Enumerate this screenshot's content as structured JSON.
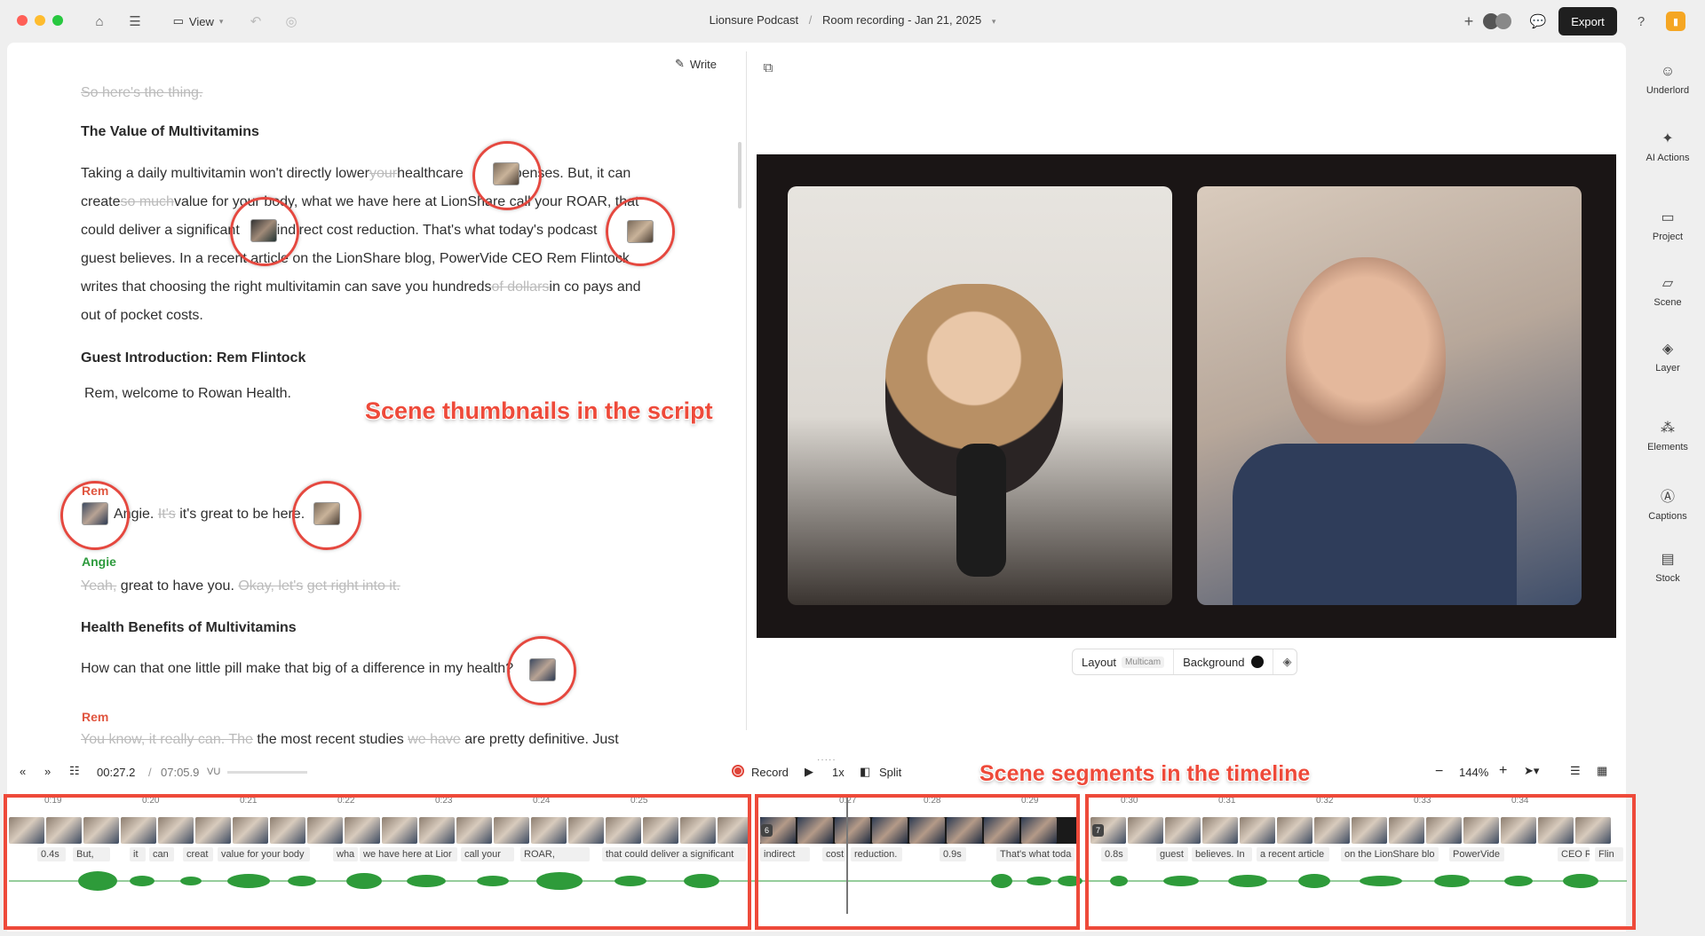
{
  "titlebar": {
    "view_label": "View",
    "project": "Lionsure Podcast",
    "separator": "/",
    "recording": "Room recording - Jan 21, 2025",
    "export_label": "Export"
  },
  "script": {
    "write_label": "Write",
    "faded_line": "So here's the thing.",
    "heading1": "The Value of Multivitamins",
    "p1": {
      "l1a": "Taking a daily multivitamin won't directly lower",
      "l1s": "your",
      "l1b": "healthcare",
      "l1c": "expenses. But, it can",
      "l2a": "create",
      "l2s": "so much",
      "l2b": "value for your body, what we have here at LionShare call your ROAR, that",
      "l3a": "could deliver a significant",
      "l3b": "indirect cost reduction. That's what today's podcast",
      "l4": "guest believes. In a recent article on the LionShare blog, PowerVide CEO Rem Flintock",
      "l5a": "writes that choosing the right multivitamin can save you hundreds",
      "l5s": "of dollars",
      "l5b": "in co pays and",
      "l6": "out of pocket costs."
    },
    "heading2": "Guest Introduction: Rem Flintock",
    "welcome": "Rem, welcome to Rowan Health.",
    "speaker_rem": "Rem",
    "rem_line_a": "Angie.",
    "rem_line_s": "It's",
    "rem_line_b": "it's great to be here.",
    "speaker_angie": "Angie",
    "angie_s1": "Yeah,",
    "angie_a": "great to have you.",
    "angie_s2": "Okay, let's",
    "angie_s3": "get right into it.",
    "heading3": "Health Benefits of Multivitamins",
    "question": "How can that one little pill make that big of a difference in my health?",
    "speaker_rem2": "Rem",
    "rem2_s1": "You know, it really can. The",
    "rem2_a": "the most recent studies",
    "rem2_s2": "we have",
    "rem2_b": "are pretty definitive. Just"
  },
  "annotations": {
    "script_callout": "Scene thumbnails in the script",
    "timeline_callout": "Scene segments in the timeline"
  },
  "preview": {
    "layout_label": "Layout",
    "layout_value": "Multicam",
    "background_label": "Background"
  },
  "sidebar": {
    "items": [
      {
        "label": "Underlord",
        "icon": "robot-icon"
      },
      {
        "label": "AI Actions",
        "icon": "sparkle-icon"
      },
      {
        "label": "Project",
        "icon": "folder-icon"
      },
      {
        "label": "Scene",
        "icon": "scene-icon"
      },
      {
        "label": "Layer",
        "icon": "layers-icon"
      },
      {
        "label": "Elements",
        "icon": "elements-icon"
      },
      {
        "label": "Captions",
        "icon": "captions-icon"
      },
      {
        "label": "Stock",
        "icon": "stock-icon"
      }
    ]
  },
  "transport": {
    "current_time": "00:27.2",
    "time_sep": "/",
    "total_time": "07:05.9",
    "vu_label": "VU",
    "record_label": "Record",
    "speed": "1x",
    "split_label": "Split",
    "zoom": "144%"
  },
  "timeline": {
    "ruler1": [
      "0:19",
      "0:20",
      "0:21",
      "0:22",
      "0:23",
      "0:24",
      "0:25"
    ],
    "ruler2": [
      "0:27",
      "0:28",
      "0:29"
    ],
    "ruler3": [
      "0:30",
      "0:31",
      "0:32",
      "0:33",
      "0:34"
    ],
    "seg1_words": [
      "0.4s",
      "But,",
      "it",
      "can",
      "creat",
      "value for your body",
      "wha",
      "we have here at Lior",
      "call your",
      "ROAR,",
      "that could deliver a significant"
    ],
    "seg2_words": [
      "indirect",
      "cost",
      "reduction.",
      "0.9s",
      "That's what toda"
    ],
    "seg3_words": [
      "0.8s",
      "guest",
      "believes. In",
      "a recent article",
      "on the LionShare blo",
      "PowerVide",
      "CEO Re",
      "Flin"
    ],
    "seg2_badge": "6",
    "seg3_badge": "7"
  }
}
